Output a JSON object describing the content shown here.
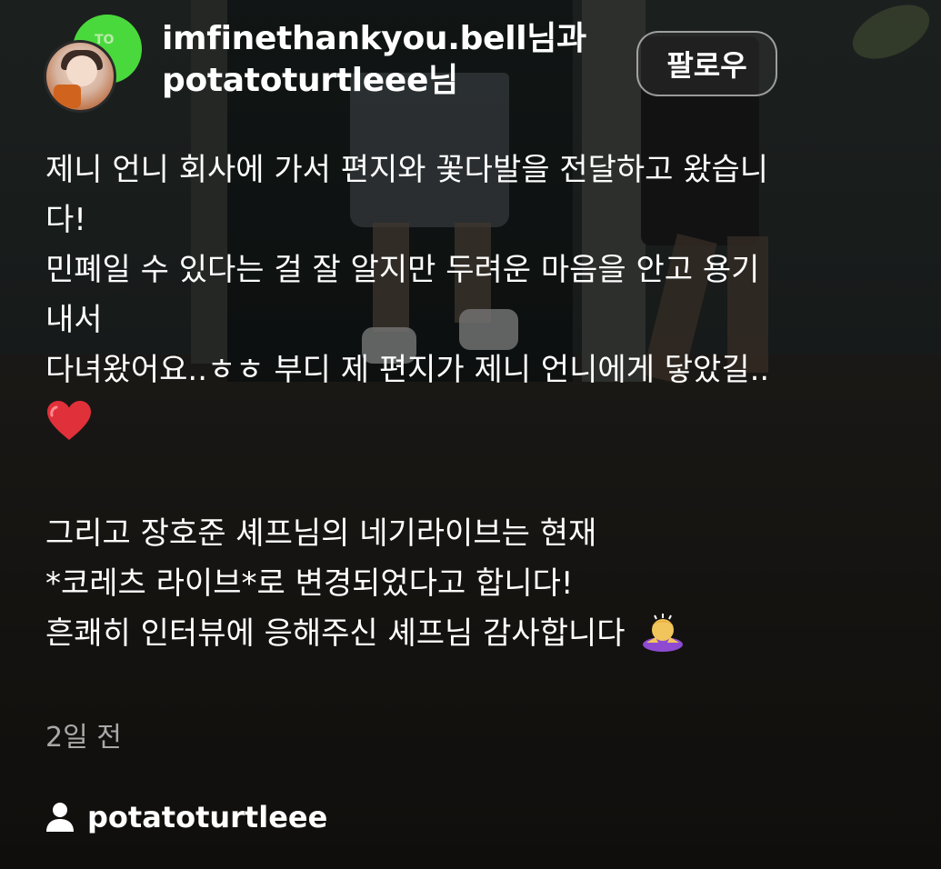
{
  "header": {
    "author_primary": "imfinethankyou.bell",
    "author_primary_suffix": "님과",
    "author_secondary": "potatoturtleee",
    "author_secondary_suffix": "님",
    "follow_label": "팔로우",
    "avatar_back_text": "TO"
  },
  "post": {
    "lines_a": [
      "제니 언니 회사에 가서 편지와 꽃다발을 전달하고 왔습니",
      "다!",
      "민폐일 수 있다는 걸 잘 알지만 두려운 마음을 안고 용기",
      "내서",
      "다녀왔어요..ㅎㅎ 부디 제 편지가 제니 언니에게 닿았길.."
    ],
    "heart_icon": "red-heart-emoji",
    "lines_b": [
      "그리고 장호준 셰프님의 네기라이브는 현재",
      "*코레츠 라이브*로 변경되었다고 합니다!",
      "흔쾌히 인터뷰에 응해주신 셰프님 감사합니다"
    ],
    "bow_icon": "person-bowing-emoji"
  },
  "meta": {
    "time": "2일 전",
    "tagged_user": "potatoturtleee",
    "tagged_icon": "person-icon"
  },
  "colors": {
    "text": "#ffffff",
    "muted": "#a9a9a9",
    "heart": "#e0303a"
  }
}
